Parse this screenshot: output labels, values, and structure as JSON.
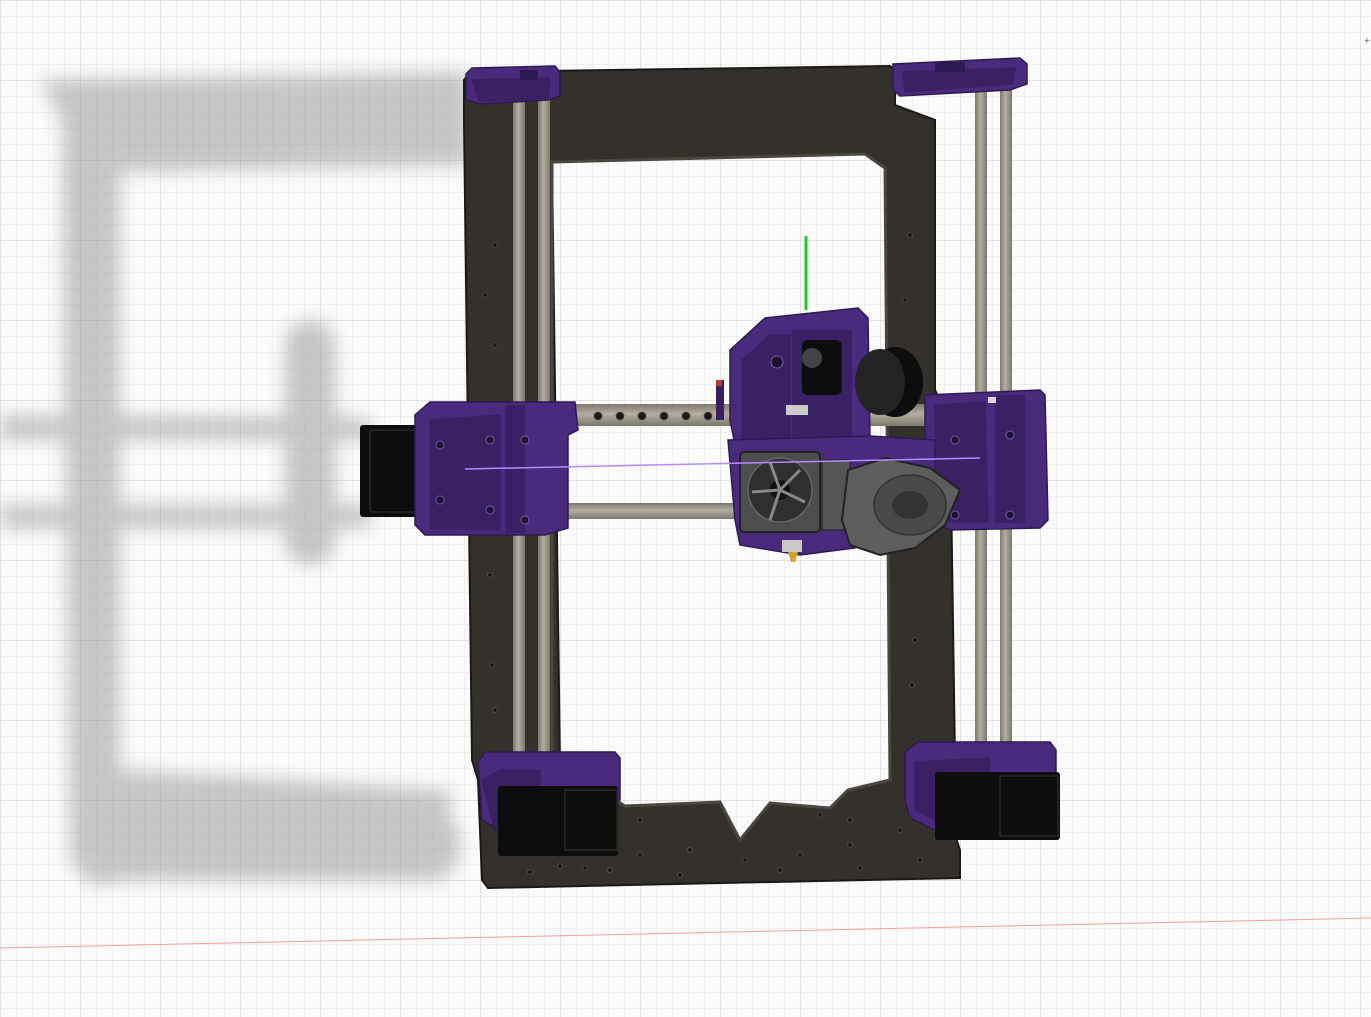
{
  "viewport": {
    "name": "3d-design-viewport",
    "background": "#fbfbfb",
    "grid_minor_color": "#e6e6e6",
    "grid_major_color": "#d2d2d2",
    "ground_line_color": "#f0a0a0"
  },
  "model": {
    "frame_color": "#34312c",
    "frame_edge_color": "#1a1917",
    "part_color": "#4a2a7c",
    "part_dark_color": "#2e1a52",
    "rod_color": "#b3aea1",
    "rod_shadow_color": "#7d786c",
    "motor_color": "#0d0d0d",
    "shadow_color": "#9a9a9a",
    "axis_y_color": "#22cc22",
    "axis_x_color": "#b38cff"
  },
  "screen_text": {
    "edge_glyph": "+"
  }
}
